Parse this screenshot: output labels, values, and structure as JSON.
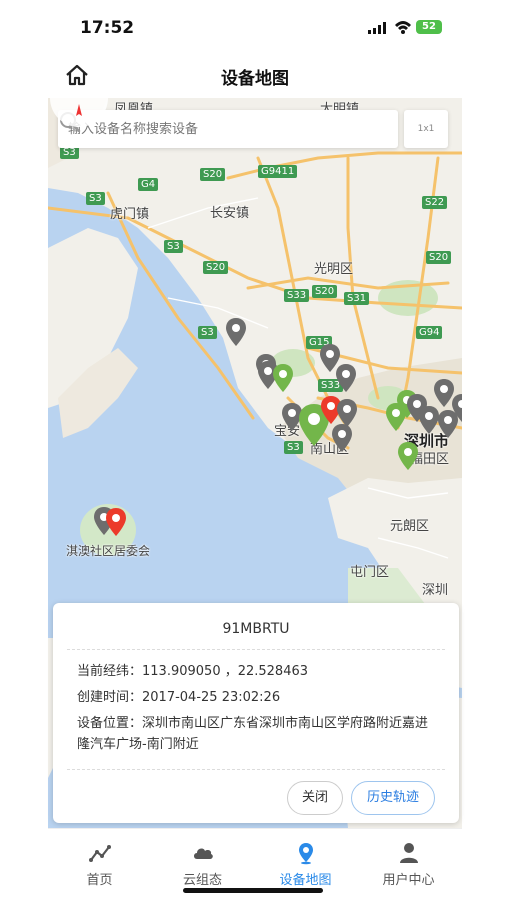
{
  "status_bar": {
    "time": "17:52",
    "battery": "52"
  },
  "header": {
    "title": "设备地图"
  },
  "search": {
    "placeholder": "输入设备名称搜索设备",
    "scale_label": "1x1"
  },
  "map": {
    "places": {
      "fuhai": "凤凰镇",
      "damingling": "大明镇",
      "humen": "虎门镇",
      "changan": "长安镇",
      "guangming": "光明区",
      "baoan": "宝安",
      "nanshan": "南山区",
      "shenzhen": "深圳市",
      "futian": "福田区",
      "yuanlang": "元朗区",
      "tuenmun": "屯门区",
      "shenzhen_south": "深圳",
      "qiao": "淇澳社区居委会"
    },
    "roads": [
      "S3",
      "G4",
      "S3",
      "S20",
      "S3",
      "S20",
      "G9411",
      "S33",
      "S20",
      "S31",
      "S22",
      "S20",
      "G15",
      "S33",
      "G94",
      "S3",
      "S3"
    ],
    "marker_colors": {
      "gray": "#6d6d6d",
      "green": "#73b64a",
      "red": "#ec3a2a"
    }
  },
  "popup": {
    "device_name": "91MBRTU",
    "coord_label": "当前经纬：",
    "coord_value": "113.909050 ，22.528463",
    "created_label": "创建时间：",
    "created_value": "2017-04-25 23:02:26",
    "location_label": "设备位置：",
    "location_value": "深圳市南山区广东省深圳市南山区学府路附近嘉进隆汽车广场-南门附近",
    "close_label": "关闭",
    "history_label": "历史轨迹"
  },
  "tabbar": {
    "items": [
      {
        "label": "首页",
        "icon": "chart-icon"
      },
      {
        "label": "云组态",
        "icon": "cloud-icon"
      },
      {
        "label": "设备地图",
        "icon": "location-icon"
      },
      {
        "label": "用户中心",
        "icon": "user-icon"
      }
    ],
    "active_color": "#2a8ae8"
  }
}
